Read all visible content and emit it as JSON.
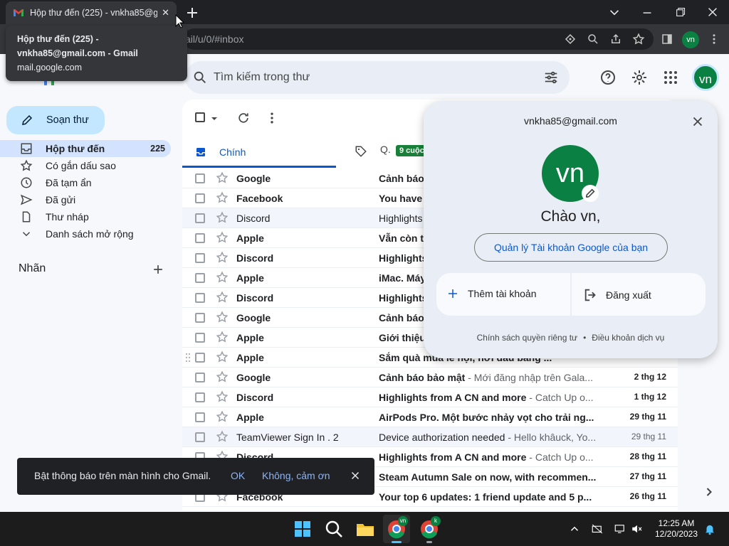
{
  "browser": {
    "tab_title": "Hộp thư đến (225) - vnkha85@gr",
    "address": "ail/u/0/#inbox",
    "profile_initials": "vn"
  },
  "tooltip": {
    "line1": "Hộp thư đến (225) -",
    "line2": "vnkha85@gmail.com - Gmail",
    "line3": "mail.google.com"
  },
  "gmail": {
    "search_placeholder": "Tìm kiếm trong thư",
    "avatar_initials": "vn"
  },
  "sidebar": {
    "compose_label": "Soạn thư",
    "items": [
      {
        "label": "Hộp thư đến",
        "count": "225",
        "icon": "inbox-icon"
      },
      {
        "label": "Có gắn dấu sao",
        "count": "",
        "icon": "star-icon"
      },
      {
        "label": "Đã tạm ẩn",
        "count": "",
        "icon": "clock-icon"
      },
      {
        "label": "Đã gửi",
        "count": "",
        "icon": "send-icon"
      },
      {
        "label": "Thư nháp",
        "count": "",
        "icon": "draft-icon"
      },
      {
        "label": "Danh sách mở rộng",
        "count": "",
        "icon": "chevron-down-icon"
      }
    ],
    "labels_heading": "Nhãn"
  },
  "tabs": {
    "primary": "Chính",
    "promotions": "Q.",
    "promotions_badge": "9 cuộc"
  },
  "emails": [
    {
      "sender": "Google",
      "subject": "Cảnh báo",
      "snippet": "",
      "date": "",
      "read": false
    },
    {
      "sender": "Facebook",
      "subject": "You have",
      "snippet": "",
      "date": "",
      "read": false
    },
    {
      "sender": "Discord",
      "subject": "Highlights",
      "snippet": "",
      "date": "",
      "read": true
    },
    {
      "sender": "Apple",
      "subject": "Vẫn còn t",
      "snippet": "",
      "date": "",
      "read": false
    },
    {
      "sender": "Discord",
      "subject": "Highlights",
      "snippet": "",
      "date": "",
      "read": false
    },
    {
      "sender": "Apple",
      "subject": "iMac. Máy",
      "snippet": "",
      "date": "",
      "read": false
    },
    {
      "sender": "Discord",
      "subject": "Highlights",
      "snippet": "",
      "date": "",
      "read": false
    },
    {
      "sender": "Google",
      "subject": "Cảnh báo",
      "snippet": "",
      "date": "",
      "read": false
    },
    {
      "sender": "Apple",
      "subject": "Giới thiệu",
      "snippet": "",
      "date": "",
      "read": false
    },
    {
      "sender": "Apple",
      "subject": "Sắm quà mùa lễ hội, nơi đấu bằng ...",
      "snippet": "",
      "date": "",
      "read": false
    },
    {
      "sender": "Google",
      "subject": "Cảnh báo bảo mật",
      "snippet": " - Mới đăng nhập trên Gala...",
      "date": "2 thg 12",
      "read": false
    },
    {
      "sender": "Discord",
      "subject": "Highlights from A CN and more",
      "snippet": " - Catch Up o...",
      "date": "1 thg 12",
      "read": false
    },
    {
      "sender": "Apple",
      "subject": "AirPods Pro. Một bước nhảy vọt cho trải ng...",
      "snippet": "",
      "date": "29 thg 11",
      "read": false
    },
    {
      "sender": "TeamViewer Sign In . 2",
      "subject": "Device authorization needed",
      "snippet": " - Hello khâuck, Yo...",
      "date": "29 thg 11",
      "read": true
    },
    {
      "sender": "Discord",
      "subject": "Highlights from A CN and more",
      "snippet": " - Catch Up o...",
      "date": "28 thg 11",
      "read": false
    },
    {
      "sender": "Steam",
      "subject": "Steam Autumn Sale on now, with recommen...",
      "snippet": "",
      "date": "27 thg 11",
      "read": false
    },
    {
      "sender": "Facebook",
      "subject": "Your top 6 updates: 1 friend update and 5 p...",
      "snippet": "",
      "date": "26 thg 11",
      "read": false
    }
  ],
  "account_popup": {
    "email": "vnkha85@gmail.com",
    "initials": "vn",
    "greeting": "Chào vn,",
    "manage": "Quản lý Tài khoản Google của bạn",
    "add_account": "Thêm tài khoản",
    "sign_out": "Đăng xuất",
    "privacy": "Chính sách quyền riêng tư",
    "terms": "Điều khoản dịch vụ",
    "separator": "•"
  },
  "snackbar": {
    "message": "Bật thông báo trên màn hình cho Gmail.",
    "ok": "OK",
    "no": "Không, cảm ơn"
  },
  "taskbar": {
    "time": "12:25 AM",
    "date": "12/20/2023",
    "chrome_badge_1": "vn",
    "chrome_badge_2": "k"
  },
  "colors": {
    "accent": "#0b57d0",
    "avatar": "#0b8043",
    "compose": "#c2e7ff",
    "active_nav": "#d3e3fd"
  }
}
